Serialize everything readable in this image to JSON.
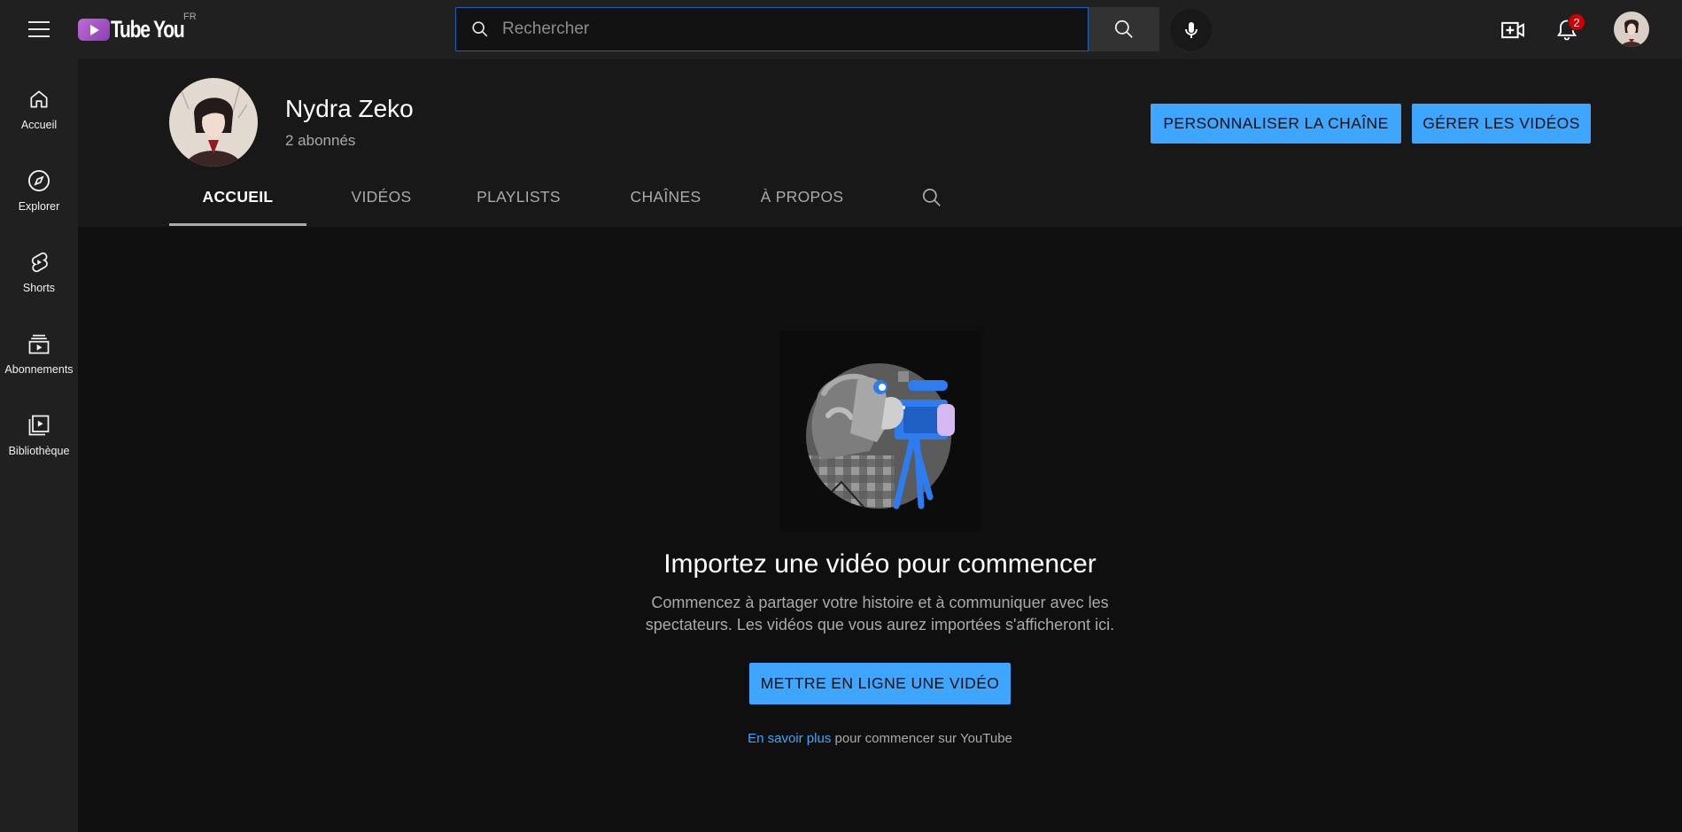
{
  "header": {
    "logo_text": "Tube You",
    "logo_country": "FR",
    "search_placeholder": "Rechercher",
    "notification_count": "2"
  },
  "sidebar": {
    "items": [
      {
        "label": "Accueil",
        "icon": "home-icon"
      },
      {
        "label": "Explorer",
        "icon": "compass-icon"
      },
      {
        "label": "Shorts",
        "icon": "shorts-icon"
      },
      {
        "label": "Abonnements",
        "icon": "subscriptions-icon"
      },
      {
        "label": "Bibliothèque",
        "icon": "library-icon"
      }
    ]
  },
  "channel": {
    "name": "Nydra Zeko",
    "subscribers": "2 abonnés",
    "customize_label": "PERSONNALISER LA CHAÎNE",
    "manage_label": "GÉRER LES VIDÉOS",
    "tabs": [
      {
        "label": "ACCUEIL",
        "active": true
      },
      {
        "label": "VIDÉOS",
        "active": false
      },
      {
        "label": "PLAYLISTS",
        "active": false
      },
      {
        "label": "CHAÎNES",
        "active": false
      },
      {
        "label": "À PROPOS",
        "active": false
      }
    ]
  },
  "empty_state": {
    "title": "Importez une vidéo pour commencer",
    "description": "Commencez à partager votre histoire et à communiquer avec les spectateurs. Les vidéos que vous aurez importées s'afficheront ici.",
    "upload_label": "METTRE EN LIGNE UNE VIDÉO",
    "learn_more_link": "En savoir plus",
    "learn_more_rest": " pour commencer sur YouTube"
  },
  "colors": {
    "accent": "#3ea6ff",
    "background": "#0f0f0f",
    "surface": "#202020",
    "channel_header": "#181818",
    "badge": "#cc0000"
  }
}
